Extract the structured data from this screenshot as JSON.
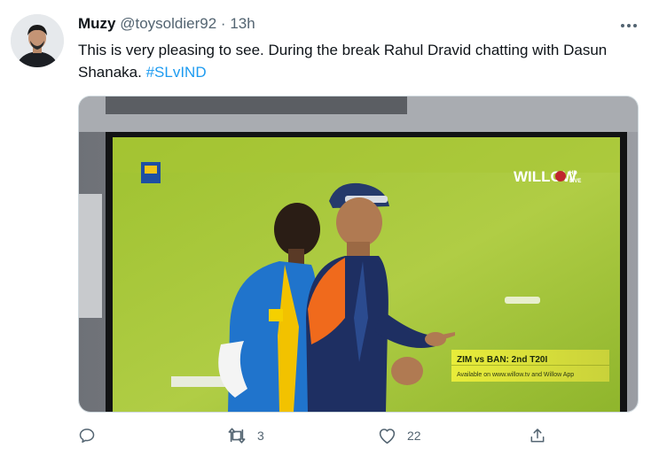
{
  "tweet": {
    "author_name": "Muzy",
    "handle": "@toysoldier92",
    "separator": "·",
    "time": "13h",
    "text": "This is very pleasing to see. During the break Rahul Dravid chatting with Dasun Shanaka.",
    "hashtag": "#SLvIND"
  },
  "media": {
    "broadcaster_logo": "WILLOW",
    "broadcaster_badge_top": "HD",
    "broadcaster_badge_bottom": "LIVE",
    "ticker_title": "ZIM vs BAN: 2nd T20I",
    "ticker_subtitle": "Available on www.willow.tv and Willow App"
  },
  "actions": {
    "reply_count": "",
    "retweet_count": "3",
    "like_count": "22"
  },
  "colors": {
    "accent": "#1d9bf0",
    "secondary_text": "#536471",
    "field_green": "#a8c93a"
  },
  "icons": [
    "more-icon",
    "reply-icon",
    "retweet-icon",
    "like-icon",
    "share-icon"
  ]
}
